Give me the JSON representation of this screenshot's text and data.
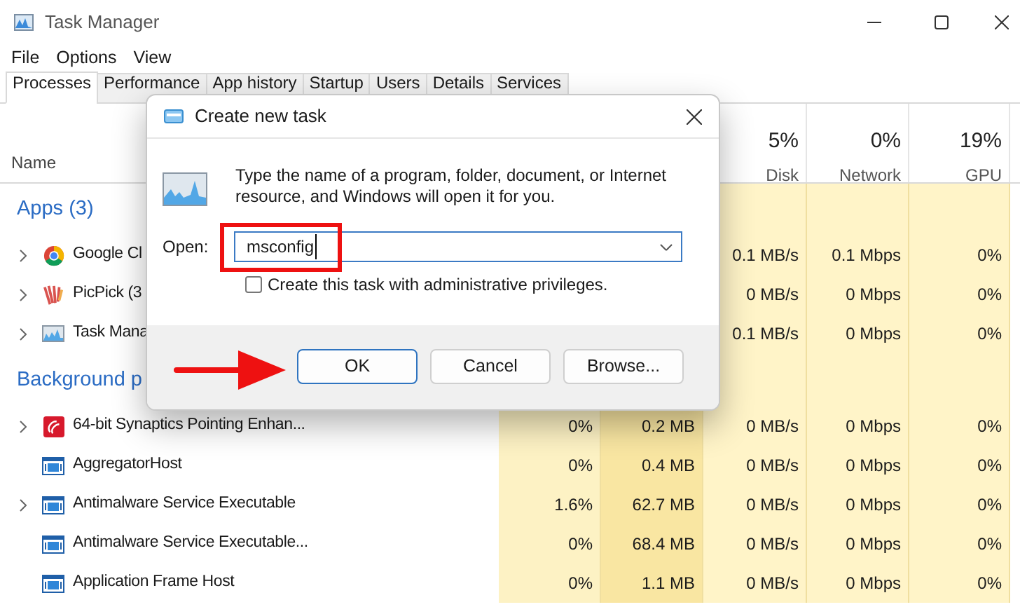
{
  "window": {
    "title": "Task Manager"
  },
  "menu": [
    "File",
    "Options",
    "View"
  ],
  "tabs": [
    {
      "label": "Processes",
      "selected": true
    },
    {
      "label": "Performance",
      "selected": false
    },
    {
      "label": "App history",
      "selected": false
    },
    {
      "label": "Startup",
      "selected": false
    },
    {
      "label": "Users",
      "selected": false
    },
    {
      "label": "Details",
      "selected": false
    },
    {
      "label": "Services",
      "selected": false
    }
  ],
  "table": {
    "name_header": "Name",
    "metric_headers": [
      {
        "percent": "5%",
        "label": "Disk"
      },
      {
        "percent": "0%",
        "label": "Network"
      },
      {
        "percent": "19%",
        "label": "GPU"
      }
    ],
    "groups": [
      {
        "title": "Apps (3)",
        "rows": [
          {
            "kind": "chrome",
            "expandable": true,
            "name": "Google Cl",
            "disk": "0.1 MB/s",
            "network": "0.1 Mbps",
            "gpu": "0%"
          },
          {
            "kind": "picpick",
            "expandable": true,
            "name": "PicPick (3",
            "disk": "0 MB/s",
            "network": "0 Mbps",
            "gpu": "0%"
          },
          {
            "kind": "taskmgr",
            "expandable": true,
            "name": "Task Mana",
            "disk": "0.1 MB/s",
            "network": "0 Mbps",
            "gpu": "0%"
          }
        ]
      },
      {
        "title": "Background p",
        "rows": [
          {
            "kind": "synaptics",
            "expandable": true,
            "name": "64-bit Synaptics Pointing Enhan...",
            "cpu": "0%",
            "memory": "0.2 MB",
            "disk": "0 MB/s",
            "network": "0 Mbps",
            "gpu": "0%"
          },
          {
            "kind": "service",
            "expandable": false,
            "name": "AggregatorHost",
            "cpu": "0%",
            "memory": "0.4 MB",
            "disk": "0 MB/s",
            "network": "0 Mbps",
            "gpu": "0%"
          },
          {
            "kind": "service",
            "expandable": true,
            "name": "Antimalware Service Executable",
            "cpu": "1.6%",
            "memory": "62.7 MB",
            "disk": "0 MB/s",
            "network": "0 Mbps",
            "gpu": "0%"
          },
          {
            "kind": "service",
            "expandable": false,
            "name": "Antimalware Service Executable...",
            "cpu": "0%",
            "memory": "68.4 MB",
            "disk": "0 MB/s",
            "network": "0 Mbps",
            "gpu": "0%"
          },
          {
            "kind": "service",
            "expandable": false,
            "name": "Application Frame Host",
            "cpu": "0%",
            "memory": "1.1 MB",
            "disk": "0 MB/s",
            "network": "0 Mbps",
            "gpu": "0%"
          }
        ]
      }
    ]
  },
  "dialog": {
    "title": "Create new task",
    "message": "Type the name of a program, folder, document, or Internet resource, and Windows will open it for you.",
    "field_label": "Open:",
    "value": "msconfig",
    "checkbox": {
      "label": "Create this task with administrative privileges.",
      "checked": false
    },
    "buttons": [
      {
        "label": "OK",
        "default": true
      },
      {
        "label": "Cancel",
        "default": false
      },
      {
        "label": "Browse...",
        "default": false
      }
    ]
  }
}
